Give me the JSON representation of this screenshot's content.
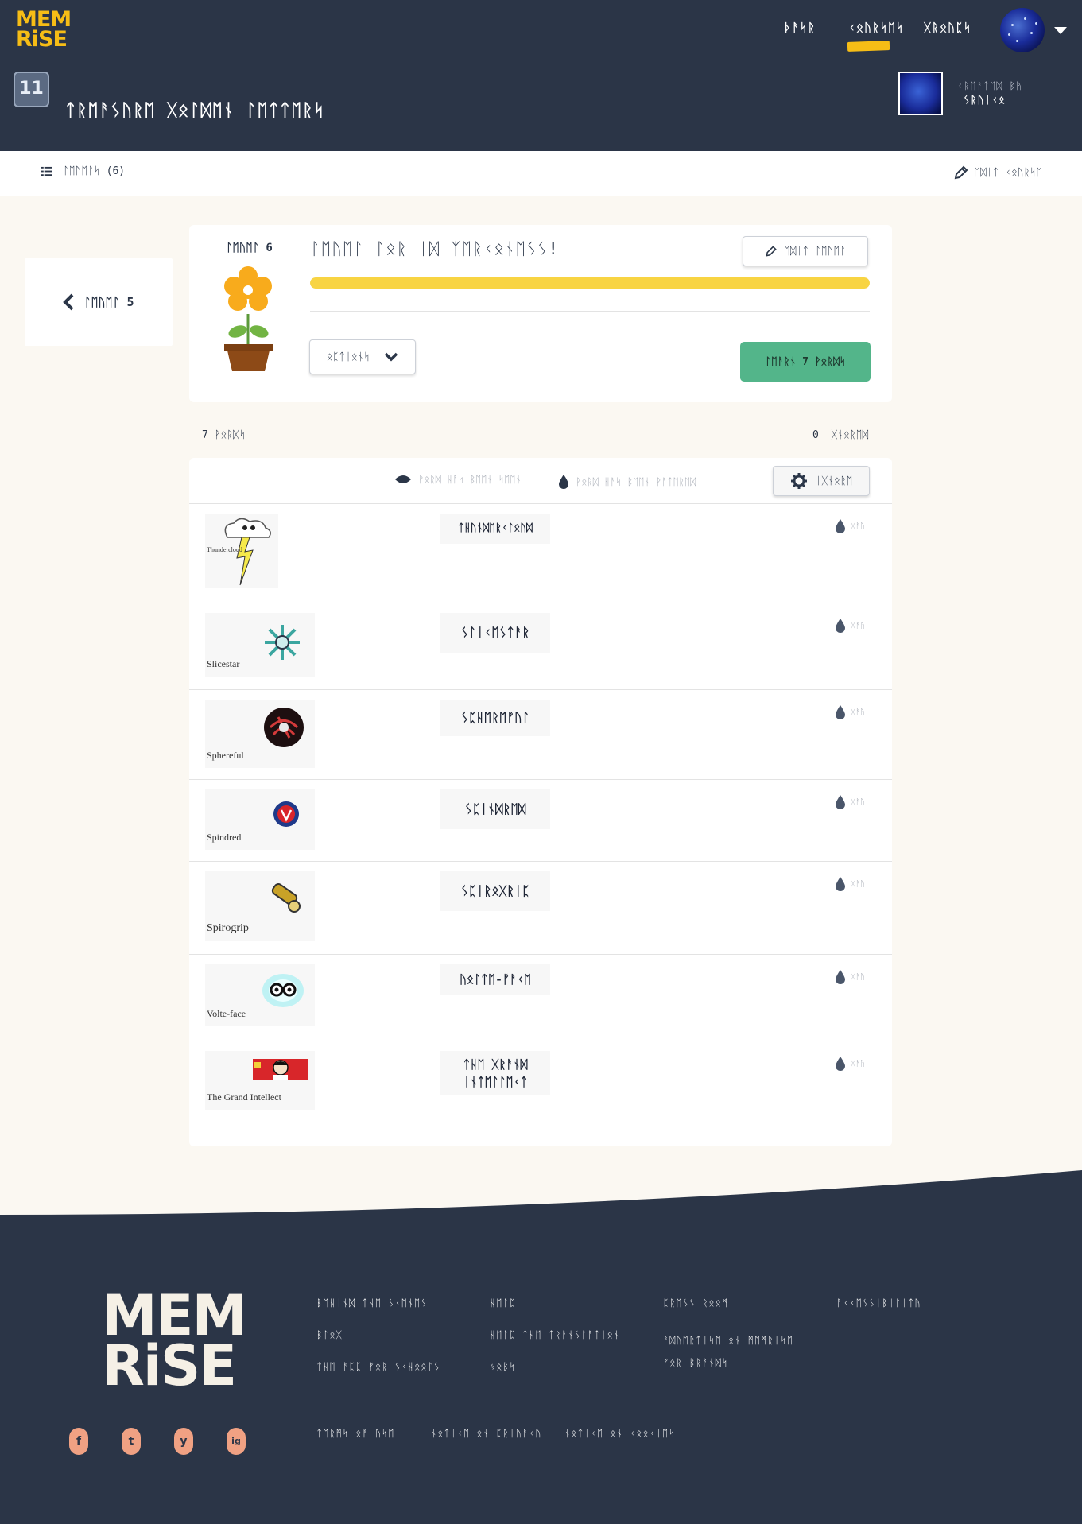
{
  "brand": {
    "logo_line1": "MEM",
    "logo_line2": "RiSE"
  },
  "header": {
    "nav": [
      "ᚦᚨᛋᚱ",
      "ᚲᛟᚢᚱᛋᛖᛋ",
      "ᚷᚱᛟᚢᛈᛋ"
    ],
    "active_nav": "ᚲᛟᚢᚱᛋᛖᛋ",
    "course_icon_text": "11",
    "course_title": "ᛏᚱᛖᚨᛊᚢᚱᛖ ᚷᛟᛚᛞᛖᚾ ᛚᛖᛏᛏᛖᚱᛋ",
    "creator_label": "ᚲᚱᛖᚨᛏᛖᛞ ᛒᚤ",
    "creator_name": "ᛊᚱᚢᛁᚲᛟ"
  },
  "subbar": {
    "levels_label": "ᛚᛖᚢᛖᛚᛋ (6)",
    "edit_course_label": "ᛖᛞᛁᛏ ᚲᛟᚢᚱᛋᛖ"
  },
  "prev_level": {
    "label": "ᛚᛖᚢᛖᛚ 5"
  },
  "level": {
    "number_label": "ᛚᛖᚢᛖᛚ 6",
    "title": "ᛚᛖᚢᛖᛚ ᛚᛟᚱ ᛁᛞ ᛉᛖᚱᚲᛟᚾᛖᛊᛊ!",
    "edit_level_label": "ᛖᛞᛁᛏ ᛚᛖᚢᛖᛚ",
    "progress": 1.0,
    "options_label": "ᛟᛈᛏᛁᛟᚾᛋ",
    "learn_label": "ᛚᛖᚨᚱᚾ 7 ᚹᛟᚱᛞᛋ",
    "words_count": "7 ᚹᛟᚱᛞᛋ",
    "ignored_count": "0 ᛁᚷᚾᛟᚱᛖᛞ"
  },
  "legend": {
    "seen_label": "ᚹᛟᚱᛞ ᚺᚨᛋ ᛒᛖᛖᚾ ᛋᛖᛖᚾ",
    "watered_label": "ᚹᛟᚱᛞ ᚺᚨᛋ ᛒᛖᛖᚾ ᚹᚨᛏᛖᚱᛖᛞ",
    "ignore_label": "ᛁᚷᚾᛟᚱᛖ"
  },
  "words": [
    {
      "caption": "Thundercloud",
      "word": "ᛏᚺᚢᚾᛞᛖᚱᚲᛚᛟᚢᛞ",
      "status": "ᛞᚨᚤ"
    },
    {
      "caption": "Slicestar",
      "word": "ᛊᛚᛁᚲᛖᛊᛏᚨᚱ",
      "status": "ᛞᚨᚤ"
    },
    {
      "caption": "Sphereful",
      "word": "ᛊᛈᚺᛖᚱᛖᚠᚢᛚ",
      "status": "ᛞᚨᚤ"
    },
    {
      "caption": "Spindred",
      "word": "ᛊᛈᛁᚾᛞᚱᛖᛞ",
      "status": "ᛞᚨᚤ"
    },
    {
      "caption": "Spirogrip",
      "word": "ᛊᛈᛁᚱᛟᚷᚱᛁᛈ",
      "status": "ᛞᚨᚤ"
    },
    {
      "caption": "Volte-face",
      "word": "ᚢᛟᛚᛏᛖ-ᚠᚨᚲᛖ",
      "status": "ᛞᚨᚤ"
    },
    {
      "caption": "The Grand Intellect",
      "word": "ᛏᚺᛖ ᚷᚱᚨᚾᛞ ᛁᚾᛏᛖᛚᛚᛖᚲᛏ",
      "status": "ᛞᚨᚤ"
    }
  ],
  "footer": {
    "col1": [
      "ᛒᛖᚺᛁᚾᛞ ᛏᚺᛖ ᛊᚲᛖᚾᛖᛊ",
      "ᛒᛚᛟᚷ",
      "ᛏᚺᛖ ᚨᛈᛈ ᚠᛟᚱ ᛊᚲᚺᛟᛟᛚᛊ"
    ],
    "col2": [
      "ᚺᛖᛚᛈ",
      "ᚺᛖᛚᛈ ᛏᚺᛖ ᛏᚱᚨᚾᛊᛚᚨᛏᛁᛟᚾ",
      "ᛃᛟᛒᛋ"
    ],
    "col3": [
      "ᛈᚱᛖᛊᛊ ᚱᛟᛟᛗ",
      "ᚨᛞᚢᛖᚱᛏᛁᛋᛖ ᛟᚾ ᛗᛖᛗᚱᛁᛋᛖ ᚠᛟᚱ ᛒᚱᚨᚾᛞᛋ"
    ],
    "col4": [
      "ᚨᚲᚲᛖᛊᛊᛁᛒᛁᛚᛁᛏᚤ"
    ],
    "legal": [
      "ᛏᛖᚱᛗᛋ ᛟᚠ ᚢᛋᛖ",
      "ᚾᛟᛏᛁᚲᛖ ᛟᚾ ᛈᚱᛁᚢᚨᚲᚤ",
      "ᚾᛟᛏᛁᚲᛖ ᛟᚾ ᚲᛟᛟᚲᛁᛖᛋ"
    ],
    "social": [
      "f",
      "t",
      "y",
      "ig"
    ]
  },
  "colors": {
    "header_bg": "#2b3547",
    "accent_yellow": "#f6bd16",
    "learn_green": "#53b58a",
    "progress_yellow": "#f8d442",
    "social_orange": "#f0a183"
  }
}
